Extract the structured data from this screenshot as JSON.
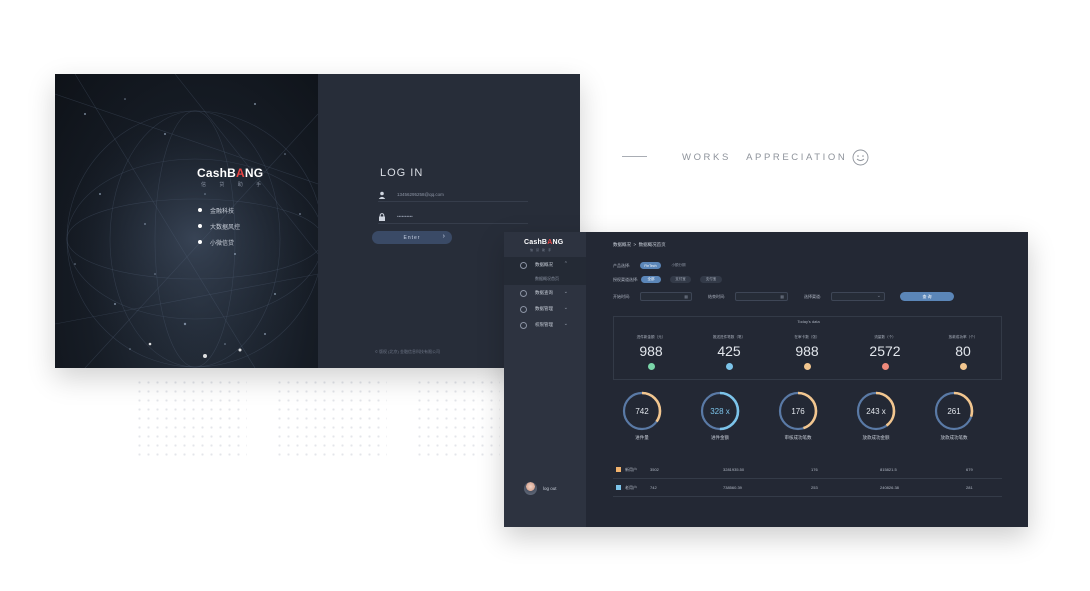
{
  "login": {
    "brand_prefix": "CashB",
    "brand_highlight": "A",
    "brand_suffix": "NG",
    "brand_sub": "信 贷 助 手",
    "features": [
      "金融科技",
      "大数据风控",
      "小微信贷"
    ],
    "title": "LOG IN",
    "username_value": "13456295258@qq.com",
    "password_value": "••••••••••",
    "enter_label": "Enter",
    "copyright": "© 版权 (北京) 金融信息科技有限公司"
  },
  "works": {
    "label": "WORKS   APPRECIATION",
    "icon": "smile-icon"
  },
  "dashboard": {
    "brand_prefix": "CashB",
    "brand_highlight": "A",
    "brand_suffix": "NG",
    "brand_sub": "信贷助手",
    "nav": [
      {
        "label": "数据概况",
        "icon": "chart-icon",
        "active": true,
        "sub": "数据概况首页"
      },
      {
        "label": "数据查询",
        "icon": "search-icon"
      },
      {
        "label": "数据管理",
        "icon": "gear-icon"
      },
      {
        "label": "权限管理",
        "icon": "shield-icon"
      }
    ],
    "user": {
      "logout_label": "log out"
    },
    "breadcrumb": "数据概况  >  数据概况首页",
    "filters": {
      "product_label": "产品选择:",
      "product_options": [
        "FinTech",
        "小额分期"
      ],
      "channel_label": "授权渠道选择:",
      "channel_options": [
        "全部",
        "支付宝",
        "支付宝"
      ],
      "start_label": "开始时间:",
      "end_label": "结束时间:",
      "category_label": "选择渠道:",
      "query_label": "查 询"
    },
    "today": {
      "title": "Today's data",
      "stats": [
        {
          "label": "进件新金额（元）",
          "value": "988",
          "color": "#7ad6a9"
        },
        {
          "label": "推送进件笔数（笔）",
          "value": "425",
          "color": "#7cc4ea"
        },
        {
          "label": "在审卡数（张）",
          "value": "988",
          "color": "#f2c68f"
        },
        {
          "label": "流量数（个）",
          "value": "2572",
          "color": "#ef8a7c"
        },
        {
          "label": "放款成功率（个）",
          "value": "80",
          "color": "#f2c68f"
        }
      ]
    },
    "rings": [
      {
        "value": "742",
        "label": "进件量",
        "color": "#f2c68f",
        "fill": 0.35
      },
      {
        "value": "328 x",
        "label": "进件金额",
        "color": "#7cc4ea",
        "fill": 0.5
      },
      {
        "value": "176",
        "label": "审核成功笔数",
        "color": "#f2c68f",
        "fill": 0.45
      },
      {
        "value": "243 x",
        "label": "放款成功金额",
        "color": "#f2c68f",
        "fill": 0.4
      },
      {
        "value": "261",
        "label": "放款成功笔数",
        "color": "#f2c68f",
        "fill": 0.3
      }
    ],
    "table": [
      {
        "name": "新用户",
        "color": "#f2b36d",
        "cells": [
          "3502",
          "3281935.50",
          "176",
          "815821.5",
          "679"
        ]
      },
      {
        "name": "老用户",
        "color": "#7cc4ea",
        "cells": [
          "742",
          "738560.39",
          "253",
          "240826.38",
          "281"
        ]
      }
    ]
  }
}
